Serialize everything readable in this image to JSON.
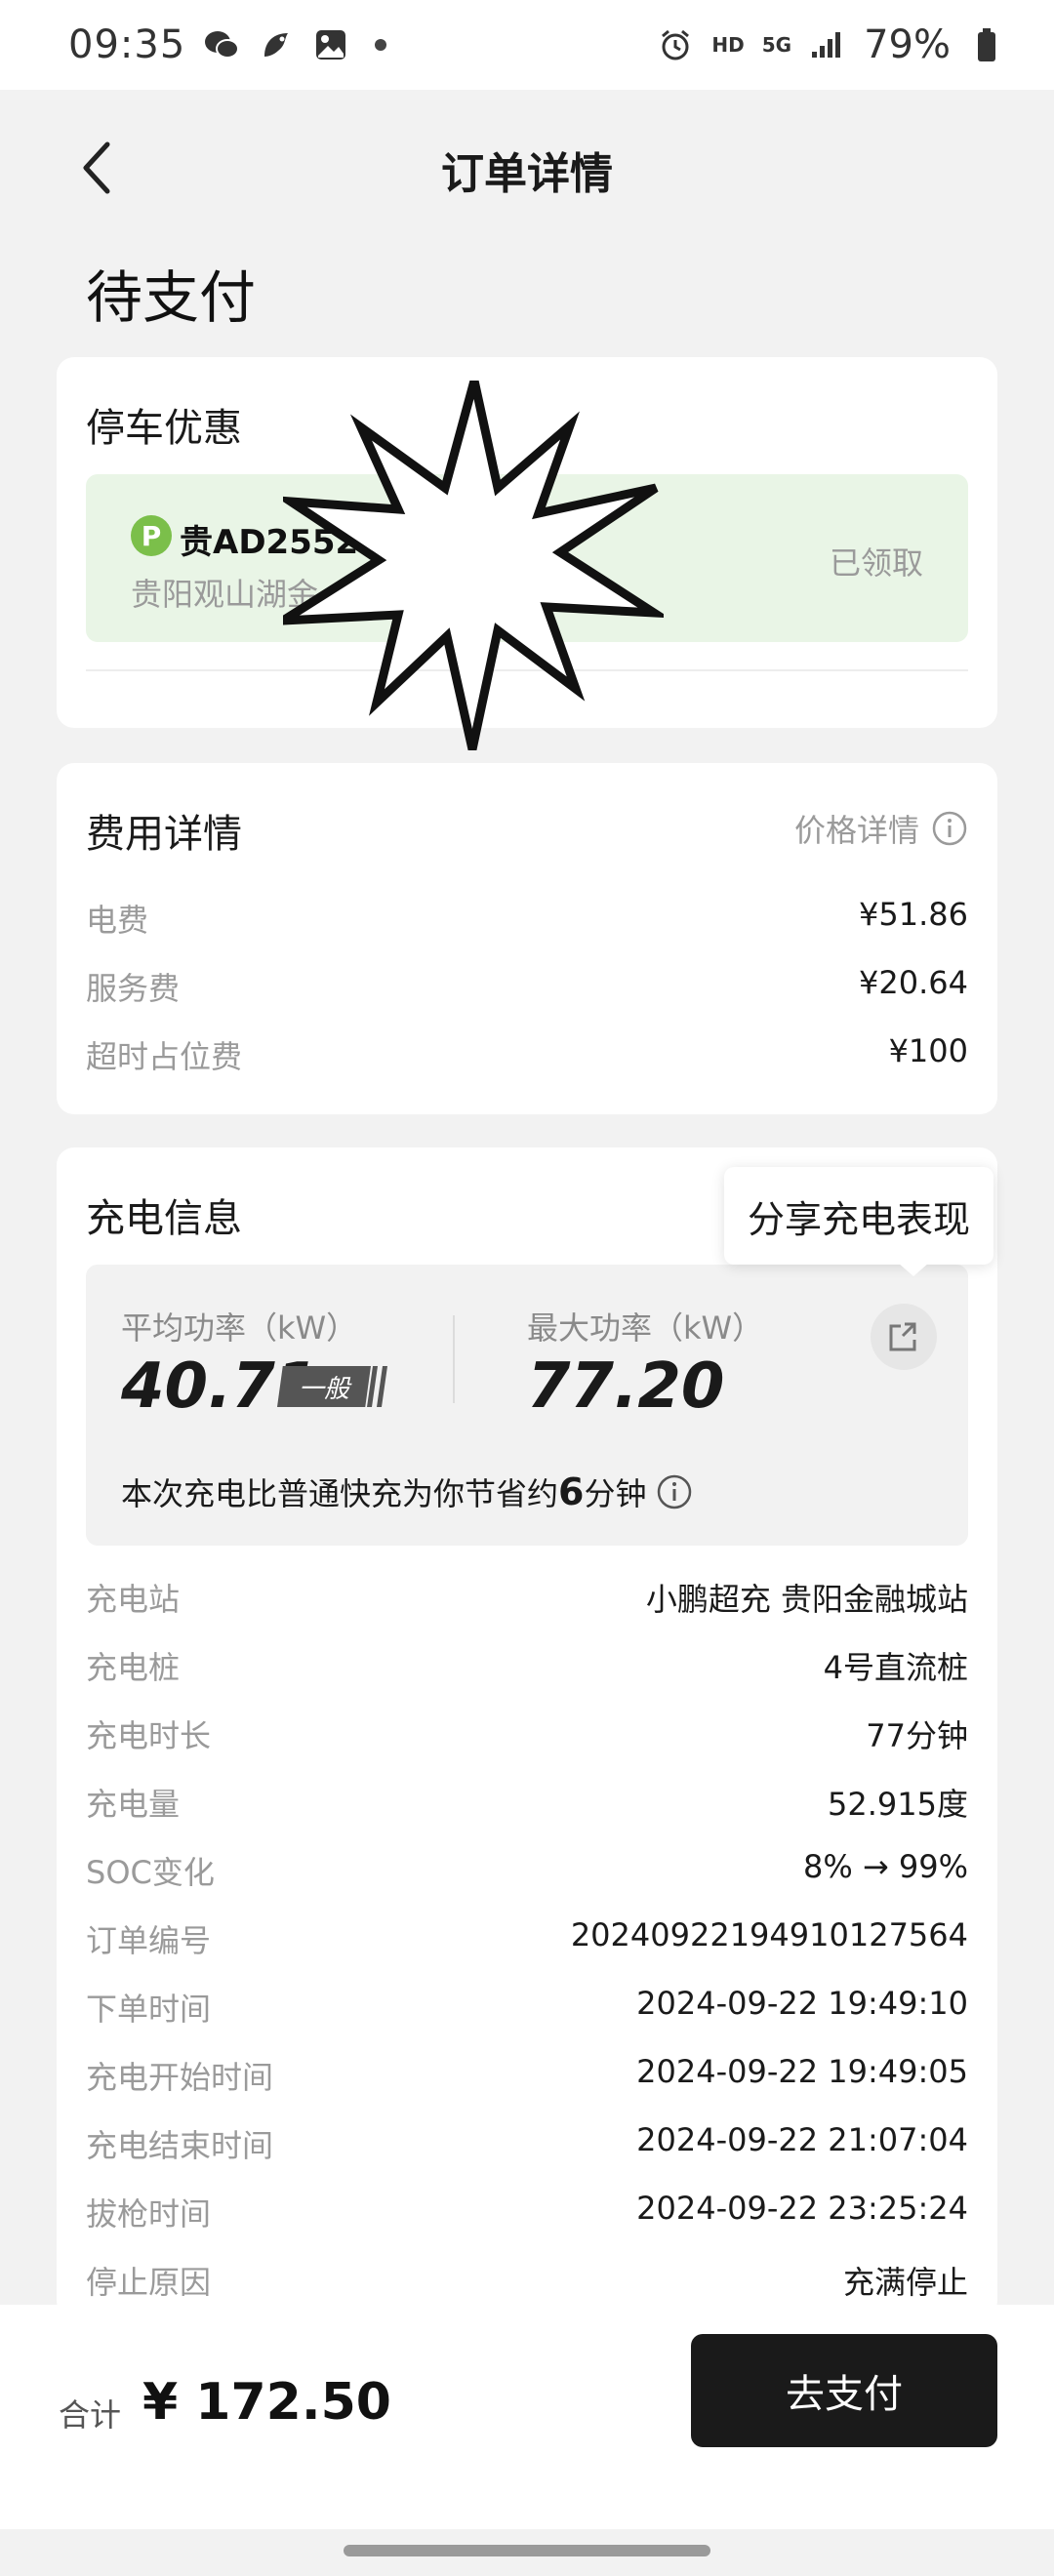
{
  "status_bar": {
    "time": "09:35",
    "left_icons": [
      "wechat-icon",
      "bird-app-icon",
      "gallery-icon"
    ],
    "right_icons": [
      "alarm-icon",
      "hd-icon",
      "5g-icon",
      "signal-icon",
      "battery-icon"
    ],
    "hd_label": "HD",
    "network_label": "5G",
    "battery": "79%"
  },
  "header": {
    "title": "订单详情",
    "back_icon": "chevron-left-icon"
  },
  "order_status": "待支付",
  "parking": {
    "title": "停车优惠",
    "plate": "贵AD2552",
    "plate_badge": "P",
    "location": "贵阳观山湖金",
    "status": "已领取"
  },
  "fees": {
    "title": "费用详情",
    "price_detail_link": "价格详情",
    "items": [
      {
        "label": "电费",
        "value": "¥51.86"
      },
      {
        "label": "服务费",
        "value": "¥20.64"
      },
      {
        "label": "超时占位费",
        "value": "¥100"
      }
    ]
  },
  "charging": {
    "title": "充电信息",
    "share_tooltip": "分享充电表现",
    "avg_power_label": "平均功率（kW）",
    "avg_power_value": "40.71",
    "avg_level": "一般",
    "max_power_label": "最大功率（kW）",
    "max_power_value": "77.20",
    "saving_prefix": "本次充电比普通快充为你节省约",
    "saving_number": "6",
    "saving_suffix": "分钟",
    "details": [
      {
        "label": "充电站",
        "value": "小鹏超充 贵阳金融城站"
      },
      {
        "label": "充电桩",
        "value": "4号直流桩"
      },
      {
        "label": "充电时长",
        "value": "77分钟"
      },
      {
        "label": "充电量",
        "value": "52.915度"
      },
      {
        "label": "SOC变化",
        "value": "8% → 99%"
      },
      {
        "label": "订单编号",
        "value": "20240922194910127564"
      },
      {
        "label": "下单时间",
        "value": "2024-09-22 19:49:10"
      },
      {
        "label": "充电开始时间",
        "value": "2024-09-22 19:49:05"
      },
      {
        "label": "充电结束时间",
        "value": "2024-09-22 21:07:04"
      },
      {
        "label": "拔枪时间",
        "value": "2024-09-22 23:25:24"
      },
      {
        "label": "停止原因",
        "value": "充满停止"
      }
    ]
  },
  "footer": {
    "total_label": "合计",
    "total_amount": "¥ 172.50",
    "pay_button": "去支付"
  },
  "colors": {
    "accent_green": "#7bbf4a",
    "parking_bg": "#e9f5e6",
    "pay_button_bg": "#1a1a1a"
  }
}
